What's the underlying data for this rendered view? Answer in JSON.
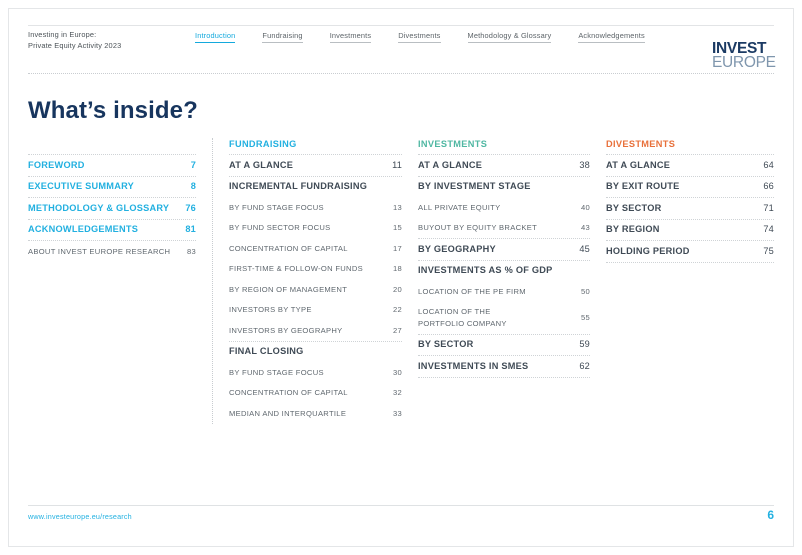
{
  "header": {
    "doc_title": "Investing in Europe:\nPrivate Equity Activity 2023",
    "nav": [
      {
        "label": "Introduction",
        "active": true
      },
      {
        "label": "Fundraising",
        "active": false
      },
      {
        "label": "Investments",
        "active": false
      },
      {
        "label": "Divestments",
        "active": false
      },
      {
        "label": "Methodology & Glossary",
        "active": false
      },
      {
        "label": "Acknowledgements",
        "active": false
      }
    ],
    "logo": {
      "line1": "INVEST",
      "line2": "EUROPE"
    }
  },
  "page_title": "What’s inside?",
  "colors": {
    "cyan": "#22b0e0",
    "teal": "#4fb7a2",
    "orange": "#e8703a",
    "navy": "#17355e",
    "slate": "#3f4a55"
  },
  "columns": [
    {
      "heading": null,
      "rows": [
        {
          "label": "FOREWORD",
          "page": "7",
          "level": "major-cy"
        },
        {
          "label": "EXECUTIVE SUMMARY",
          "page": "8",
          "level": "major-cy"
        },
        {
          "label": "METHODOLOGY & GLOSSARY",
          "page": "76",
          "level": "major-cy"
        },
        {
          "label": "ACKNOWLEDGEMENTS",
          "page": "81",
          "level": "major-cy"
        },
        {
          "label": "ABOUT INVEST EUROPE RESEARCH",
          "page": "83",
          "level": "sub"
        }
      ]
    },
    {
      "heading": {
        "label": "FUNDRAISING",
        "color": "cyan"
      },
      "rows": [
        {
          "label": "AT A GLANCE",
          "page": "11",
          "level": "section"
        },
        {
          "label": "INCREMENTAL FUNDRAISING",
          "page": "",
          "level": "section"
        },
        {
          "label": "BY FUND STAGE FOCUS",
          "page": "13",
          "level": "sub",
          "no_rule": true
        },
        {
          "label": "BY FUND SECTOR FOCUS",
          "page": "15",
          "level": "sub",
          "no_rule": true
        },
        {
          "label": "CONCENTRATION OF CAPITAL",
          "page": "17",
          "level": "sub",
          "no_rule": true
        },
        {
          "label": "FIRST-TIME & FOLLOW-ON FUNDS",
          "page": "18",
          "level": "sub",
          "no_rule": true
        },
        {
          "label": "BY REGION OF MANAGEMENT",
          "page": "20",
          "level": "sub",
          "no_rule": true
        },
        {
          "label": "INVESTORS BY TYPE",
          "page": "22",
          "level": "sub",
          "no_rule": true
        },
        {
          "label": "INVESTORS BY GEOGRAPHY",
          "page": "27",
          "level": "sub",
          "no_rule": true
        },
        {
          "label": "FINAL CLOSING",
          "page": "",
          "level": "section"
        },
        {
          "label": "BY FUND STAGE FOCUS",
          "page": "30",
          "level": "sub",
          "no_rule": true
        },
        {
          "label": "CONCENTRATION OF CAPITAL",
          "page": "32",
          "level": "sub",
          "no_rule": true
        },
        {
          "label": "MEDIAN AND INTERQUARTILE",
          "page": "33",
          "level": "sub",
          "no_rule": true
        }
      ]
    },
    {
      "heading": {
        "label": "INVESTMENTS",
        "color": "teal"
      },
      "rows": [
        {
          "label": "AT A GLANCE",
          "page": "38",
          "level": "section"
        },
        {
          "label": "BY INVESTMENT STAGE",
          "page": "",
          "level": "section"
        },
        {
          "label": "ALL PRIVATE EQUITY",
          "page": "40",
          "level": "sub",
          "no_rule": true
        },
        {
          "label": "BUYOUT BY EQUITY BRACKET",
          "page": "43",
          "level": "sub",
          "no_rule": true
        },
        {
          "label": "BY GEOGRAPHY",
          "page": "45",
          "level": "section"
        },
        {
          "label": "INVESTMENTS AS % OF GDP",
          "page": "",
          "level": "section"
        },
        {
          "label": "LOCATION OF THE PE FIRM",
          "page": "50",
          "level": "sub",
          "no_rule": true
        },
        {
          "label": "LOCATION OF THE PORTFOLIO COMPANY",
          "page": "55",
          "level": "sub",
          "no_rule": true,
          "wrap": true
        },
        {
          "label": "BY SECTOR",
          "page": "59",
          "level": "section"
        },
        {
          "label": "INVESTMENTS IN SMES",
          "page": "62",
          "level": "section",
          "last": true
        }
      ]
    },
    {
      "heading": {
        "label": "DIVESTMENTS",
        "color": "orange"
      },
      "rows": [
        {
          "label": "AT A GLANCE",
          "page": "64",
          "level": "section"
        },
        {
          "label": "BY EXIT ROUTE",
          "page": "66",
          "level": "section"
        },
        {
          "label": "BY SECTOR",
          "page": "71",
          "level": "section"
        },
        {
          "label": "BY REGION",
          "page": "74",
          "level": "section"
        },
        {
          "label": "HOLDING PERIOD",
          "page": "75",
          "level": "section",
          "last": true
        }
      ]
    }
  ],
  "footer": {
    "url": "www.investeurope.eu/research",
    "page_number": "6"
  }
}
